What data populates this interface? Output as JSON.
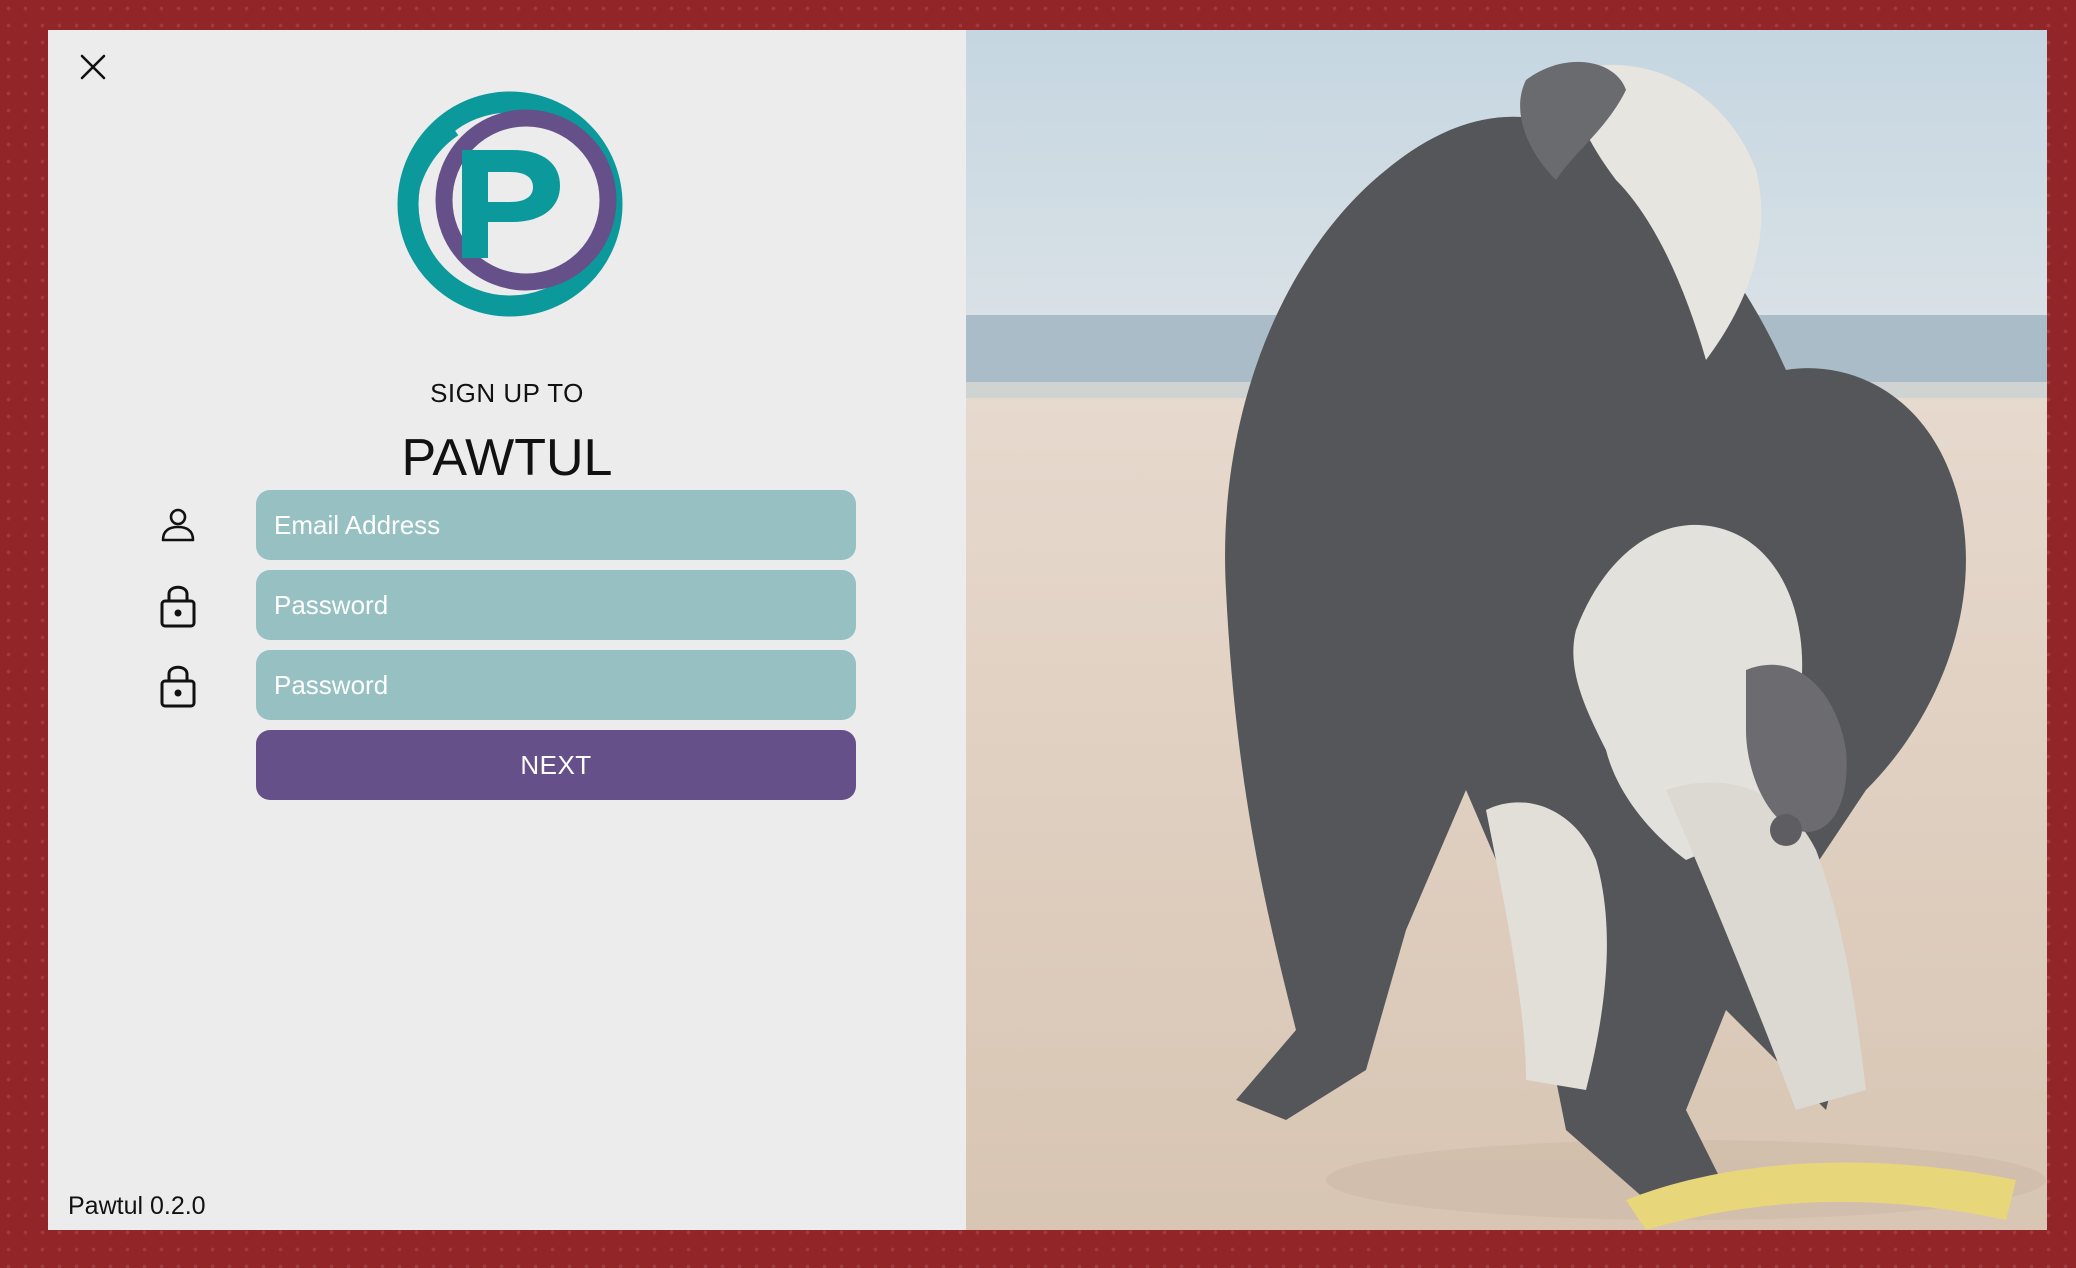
{
  "app": {
    "subtitle": "SIGN UP TO",
    "title": "PAWTUL",
    "version": "Pawtul 0.2.0"
  },
  "icons": {
    "close": "close-icon",
    "logo": "pawtul-logo",
    "email": "person-icon",
    "password": "lock-icon"
  },
  "form": {
    "email": {
      "placeholder": "Email Address",
      "value": ""
    },
    "password": {
      "placeholder": "Password",
      "value": ""
    },
    "confirm_password": {
      "placeholder": "Password",
      "value": ""
    },
    "next_label": "NEXT"
  },
  "colors": {
    "window_frame": "#922528",
    "panel_background": "#ececec",
    "field_background": "#97c0c3",
    "button_background": "#66508a",
    "logo_teal": "#0b999c",
    "logo_purple": "#66508a"
  },
  "hero_image": {
    "subject": "dog-on-beach-photo"
  }
}
